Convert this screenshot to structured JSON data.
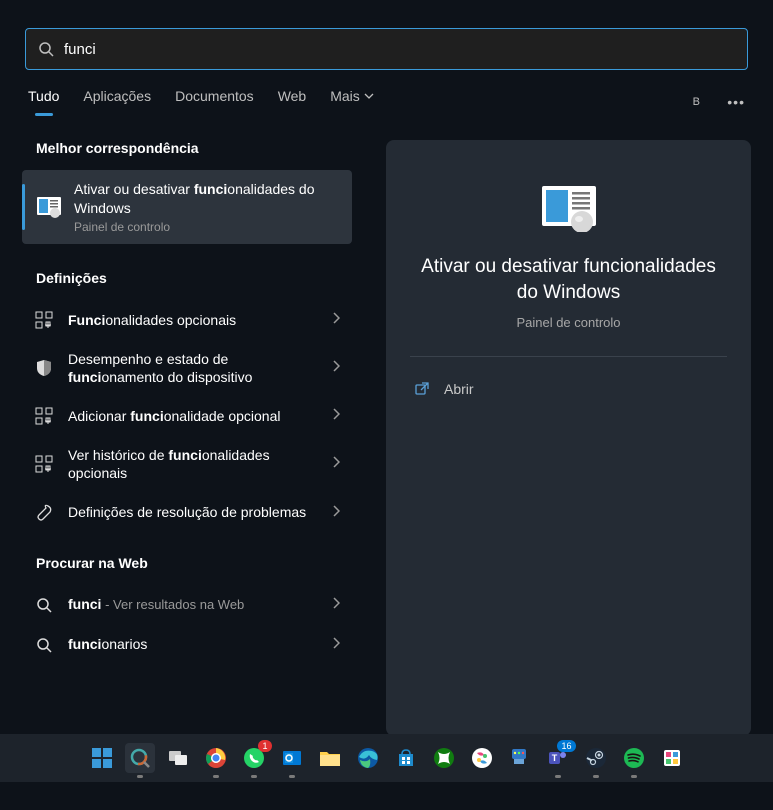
{
  "search": {
    "value": "funci"
  },
  "tabs": [
    "Tudo",
    "Aplicações",
    "Documentos",
    "Web",
    "Mais"
  ],
  "user_initial": "B",
  "sections": {
    "best_match": "Melhor correspondência",
    "settings": "Definições",
    "web": "Procurar na Web"
  },
  "best_match": {
    "pre": "Ativar ou desativar ",
    "bold": "funci",
    "post": "onalidades do Windows",
    "sub": "Painel de controlo"
  },
  "settings_items": [
    {
      "icon": "grid",
      "pre": "",
      "bold": "Funci",
      "post": "onalidades opcionais"
    },
    {
      "icon": "shield",
      "pre": "Desempenho e estado de ",
      "bold": "funci",
      "post": "onamento do dispositivo"
    },
    {
      "icon": "grid",
      "pre": "Adicionar ",
      "bold": "funci",
      "post": "onalidade opcional"
    },
    {
      "icon": "grid",
      "pre": "Ver histórico de ",
      "bold": "funci",
      "post": "onalidades opcionais"
    },
    {
      "icon": "wrench",
      "pre": "Definições de resolução de problemas",
      "bold": "",
      "post": ""
    }
  ],
  "web_items": [
    {
      "pre": "",
      "bold": "funci",
      "post": "",
      "suffix": " - Ver resultados na Web"
    },
    {
      "pre": "",
      "bold": "funci",
      "post": "onarios",
      "suffix": ""
    }
  ],
  "preview": {
    "title": "Ativar ou desativar funcionalidades do Windows",
    "sub": "Painel de controlo",
    "action": "Abrir"
  },
  "taskbar_badges": {
    "whatsapp": "1",
    "teams": "16"
  }
}
